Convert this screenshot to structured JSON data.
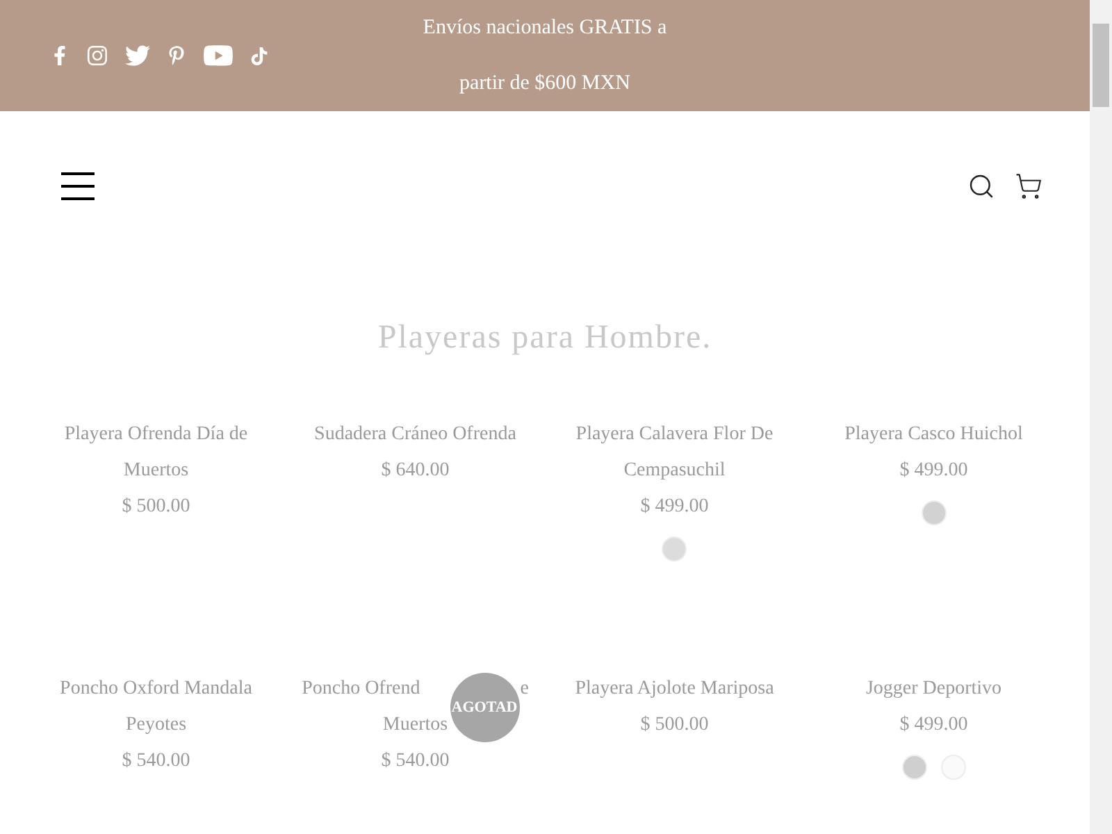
{
  "announcement": {
    "lines": [
      "Envíos nacionales GRATIS a",
      "partir de $600 MXN"
    ]
  },
  "collection": {
    "title": "Playeras para Hombre."
  },
  "products": [
    {
      "title": "Playera Ofrenda Día de Muertos",
      "price": "$ 500.00"
    },
    {
      "title": "Sudadera Cráneo Ofrenda",
      "price": "$ 640.00"
    },
    {
      "title": "Playera Calavera Flor De Cempasuchil",
      "price": "$ 499.00",
      "swatches": [
        {
          "color": "#dcdcdc"
        }
      ]
    },
    {
      "title": "Playera Casco Huichol",
      "price": "$ 499.00",
      "swatches": [
        {
          "color": "#d2d2d2"
        }
      ]
    },
    {
      "title": "Poncho Oxford Mandala Peyotes",
      "price": "$ 540.00"
    },
    {
      "title_lines": [
        [
          "Poncho Ofrend",
          "e"
        ],
        [
          "Muertos"
        ]
      ],
      "price": "$ 540.00",
      "badge": "AGOTAD"
    },
    {
      "title": "Playera Ajolote Mariposa",
      "price": "$ 500.00"
    },
    {
      "title": "Jogger Deportivo",
      "price": "$ 499.00",
      "swatches": [
        {
          "color": "#cfcfcf"
        },
        {
          "color": "#fafafa"
        }
      ]
    }
  ]
}
